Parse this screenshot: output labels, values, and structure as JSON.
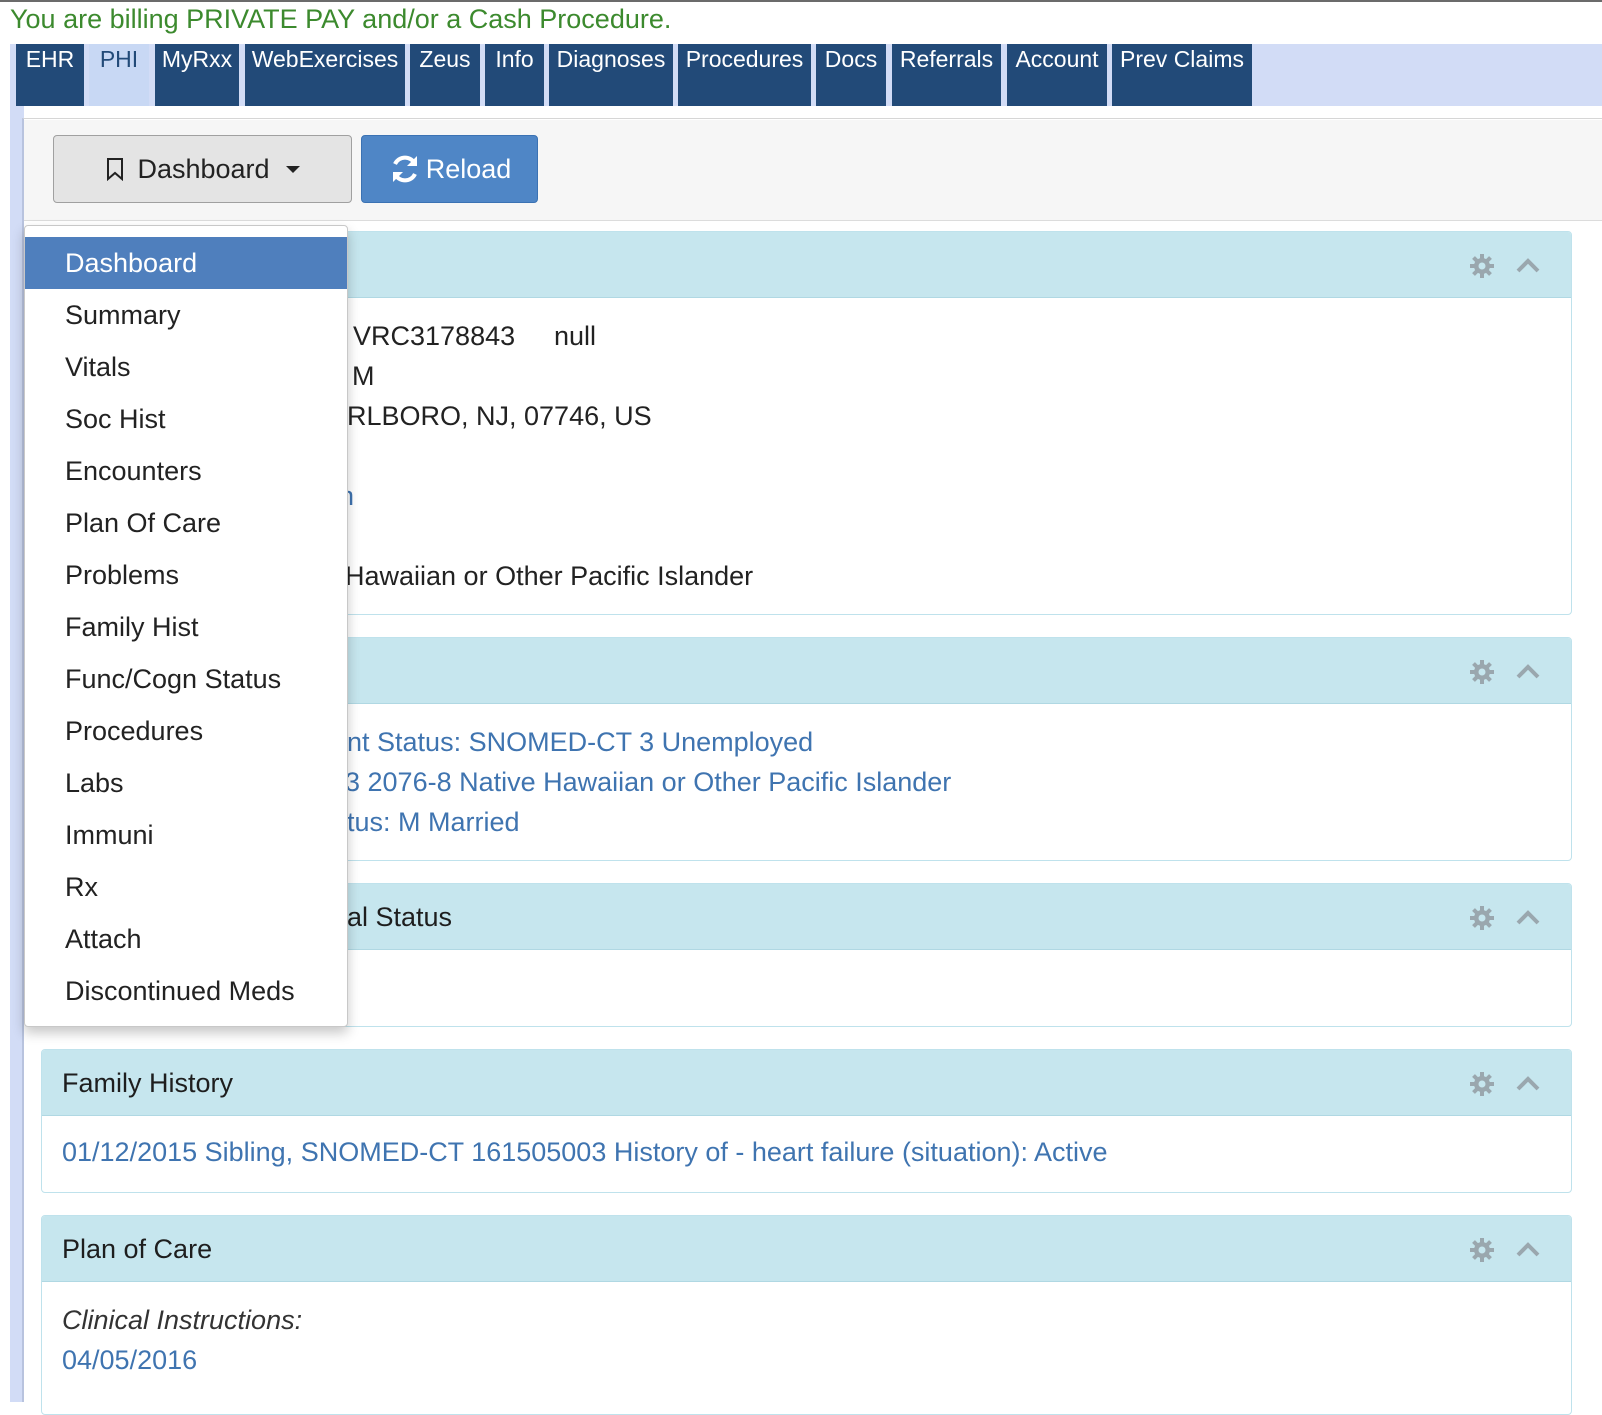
{
  "billing_note": "You are billing PRIVATE PAY and/or a Cash Procedure.",
  "tabs": [
    {
      "label": "EHR",
      "active": false
    },
    {
      "label": "PHI",
      "active": true
    },
    {
      "label": "MyRxx",
      "active": false
    },
    {
      "label": "WebExercises",
      "active": false
    },
    {
      "label": "Zeus",
      "active": false
    },
    {
      "label": "Info",
      "active": false
    },
    {
      "label": "Diagnoses",
      "active": false
    },
    {
      "label": "Procedures",
      "active": false
    },
    {
      "label": "Docs",
      "active": false
    },
    {
      "label": "Referrals",
      "active": false
    },
    {
      "label": "Account",
      "active": false
    },
    {
      "label": "Prev Claims",
      "active": false
    }
  ],
  "toolbar": {
    "dashboard_label": "Dashboard",
    "reload_label": "Reload"
  },
  "dropdown": {
    "items": [
      "Dashboard",
      "Summary",
      "Vitals",
      "Soc Hist",
      "Encounters",
      "Plan Of Care",
      "Problems",
      "Family Hist",
      "Func/Cogn Status",
      "Procedures",
      "Labs",
      "Immuni",
      "Rx",
      "Attach",
      "Discontinued Meds"
    ],
    "selected": "Dashboard"
  },
  "panels": {
    "demographics": {
      "id_value": "VRC3178843",
      "null_text": "null",
      "sex_line": ": M",
      "address_line": "RLBORO, NJ, 07746, US",
      "link_fragment": "n",
      "race_line": "Hawaiian or Other Pacific Islander"
    },
    "social": {
      "employment_line": "nt Status: SNOMED-CT 3 Unemployed",
      "race_line": "3 2076-8 Native Hawaiian or Other Pacific Islander",
      "marital_line": "tus: M Married"
    },
    "functional": {
      "title_fragment": "al Status"
    },
    "family_history": {
      "title": "Family History",
      "entry": "01/12/2015 Sibling, SNOMED-CT 161505003 History of - heart failure (situation): Active"
    },
    "plan_of_care": {
      "title": "Plan of Care",
      "instructions_label": "Clinical Instructions:",
      "date": "04/05/2016"
    }
  },
  "colors": {
    "tab_bg": "#224a78",
    "tab_active_bg": "#c8d8f4",
    "panel_head_bg": "#c6e6ee",
    "link": "#3f74b0",
    "billing_text": "#3c8a2e",
    "reload_bg": "#4f86c6",
    "dropdown_selected_bg": "#4f7fbd"
  }
}
